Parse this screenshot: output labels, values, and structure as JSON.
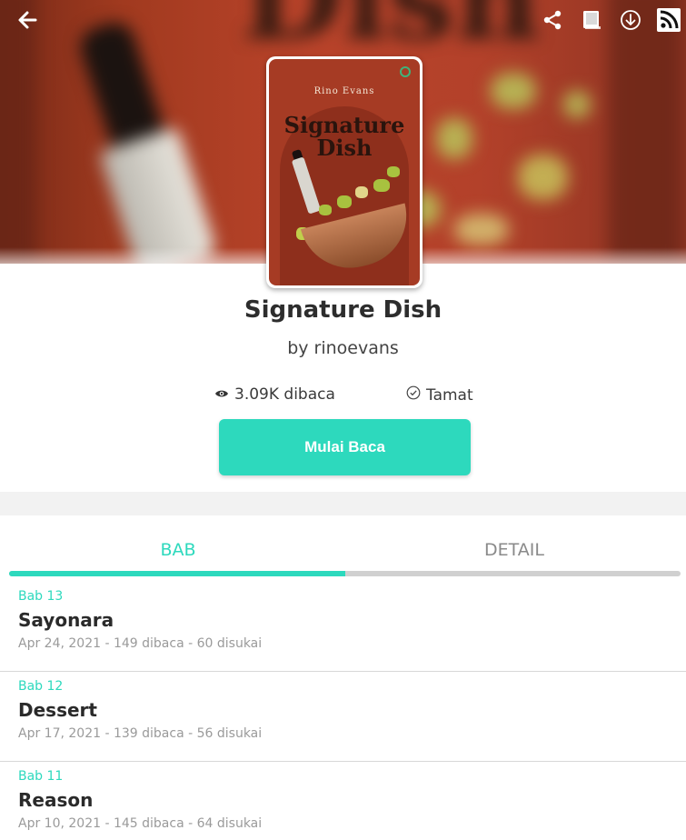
{
  "header": {
    "icons": [
      "back-arrow-icon",
      "share-icon",
      "book-icon",
      "download-icon",
      "rss-icon"
    ]
  },
  "cover": {
    "author": "Rino Evans",
    "title_line1": "Signature",
    "title_line2": "Dish"
  },
  "book": {
    "title": "Signature Dish",
    "byline": "by rinoevans",
    "reads": "3.09K dibaca",
    "status": "Tamat",
    "cta_label": "Mulai Baca"
  },
  "tabs": [
    {
      "label": "BAB",
      "active": true
    },
    {
      "label": "DETAIL",
      "active": false
    }
  ],
  "chapters": [
    {
      "number": "Bab 13",
      "title": "Sayonara",
      "meta": "Apr 24, 2021 - 149 dibaca - 60 disukai"
    },
    {
      "number": "Bab 12",
      "title": "Dessert",
      "meta": "Apr 17, 2021 - 139 dibaca - 56 disukai"
    },
    {
      "number": "Bab 11",
      "title": "Reason",
      "meta": "Apr 10, 2021 - 145 dibaca - 64 disukai"
    }
  ],
  "colors": {
    "accent": "#2dd9bd",
    "hero": "#b3412a"
  }
}
